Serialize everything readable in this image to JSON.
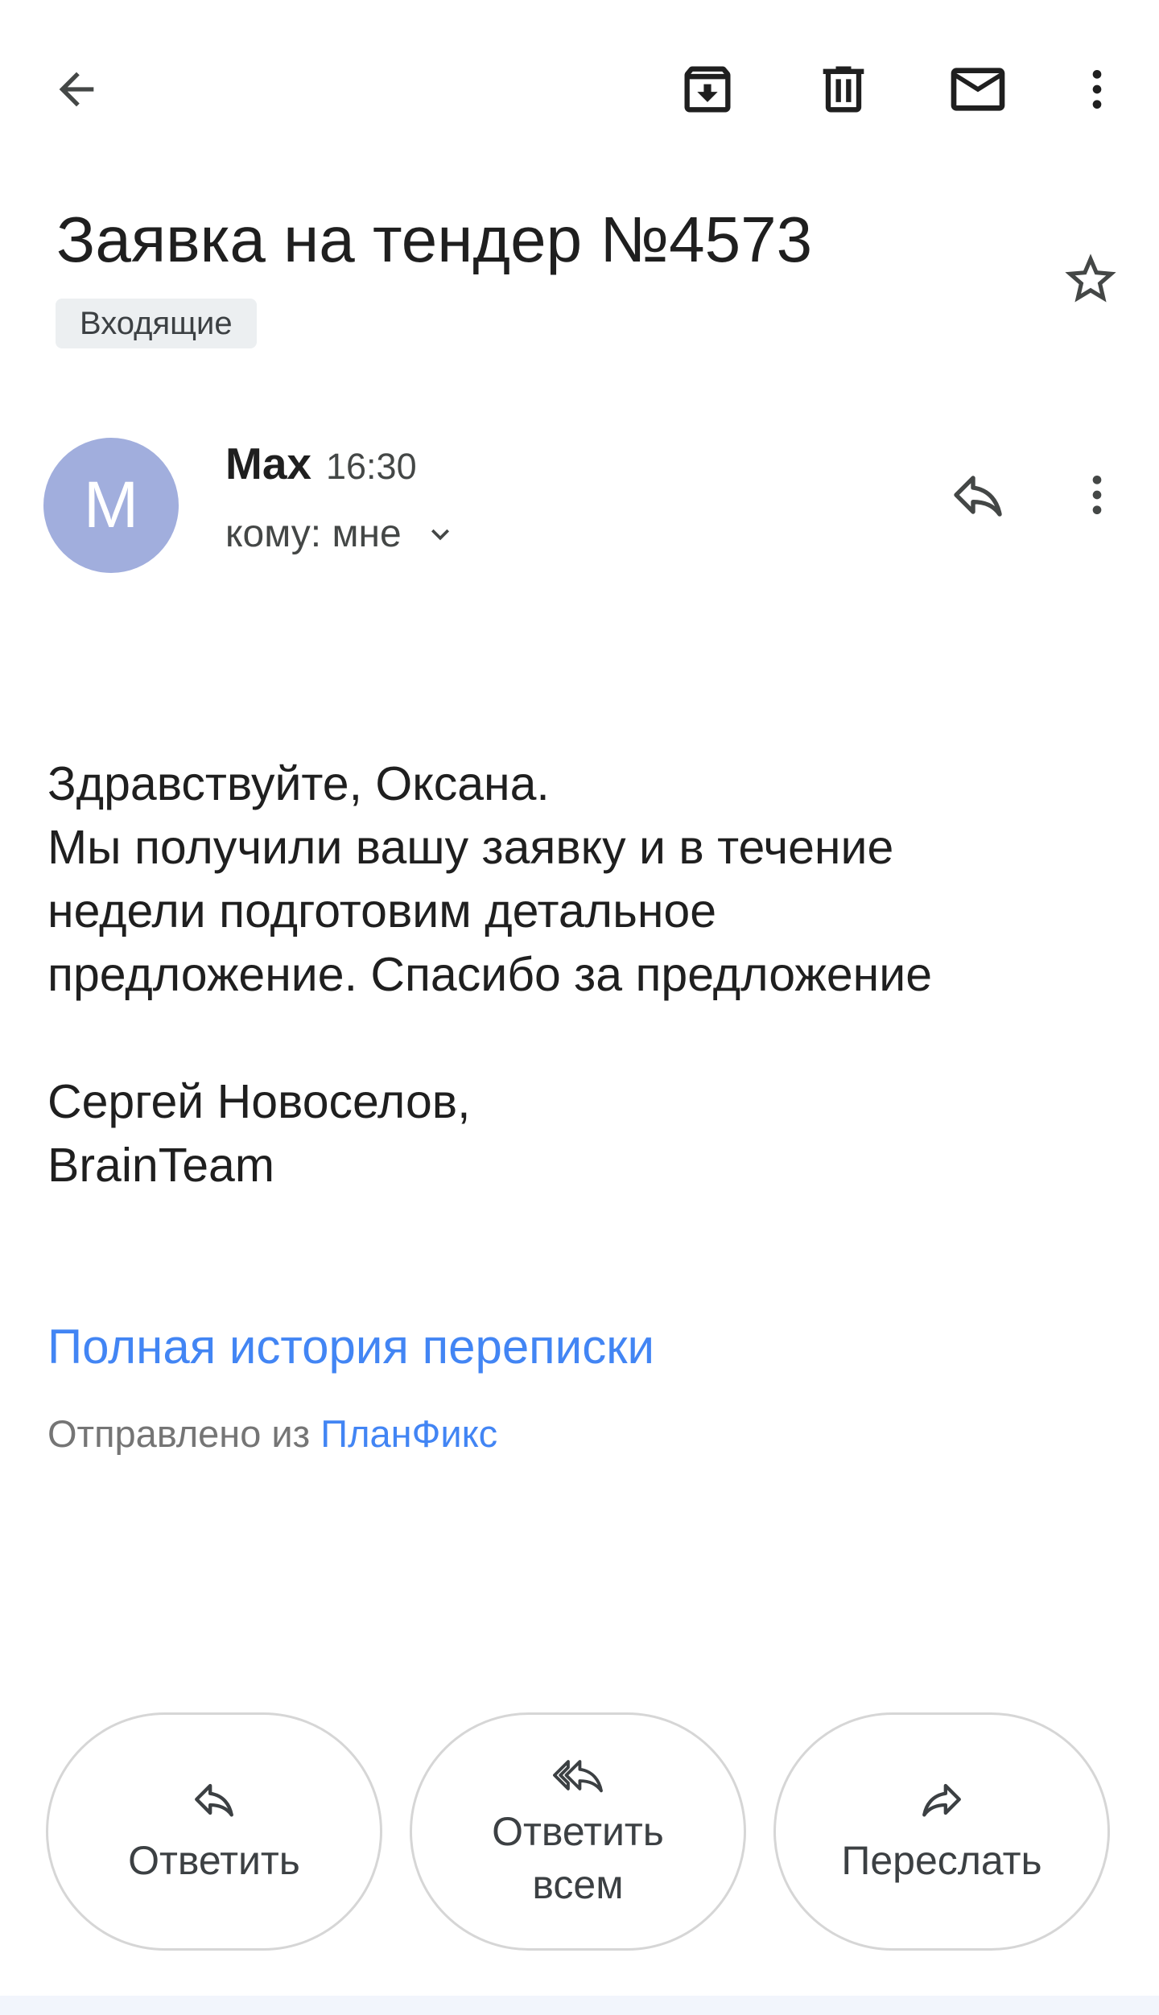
{
  "toolbar": {
    "back_icon": "arrow-back-icon",
    "archive_icon": "archive-icon",
    "delete_icon": "trash-icon",
    "mark_unread_icon": "mail-icon",
    "more_icon": "more-vert-icon"
  },
  "email": {
    "subject": "Заявка на тендер №4573",
    "label": "Входящие",
    "star_icon": "star-outline-icon",
    "sender": {
      "avatar_letter": "M",
      "avatar_color": "#a1aedd",
      "name": "Max",
      "time": "16:30",
      "recipient": "кому: мне"
    },
    "body": {
      "greeting": "Здравствуйте, Оксана.",
      "lines": [
        "Мы получили вашу заявку и в течение",
        "недели подготовим детальное",
        "предложение. Спасибо за предложение"
      ],
      "signature": [
        "Сергей Новоселов,",
        "BrainTeam"
      ]
    },
    "history_link": "Полная история переписки",
    "sent_from_prefix": "Отправлено из",
    "sent_from_app": "ПланФикс"
  },
  "actions": {
    "reply": "Ответить",
    "reply_all_line1": "Ответить",
    "reply_all_line2": "всем",
    "forward": "Переслать"
  },
  "colors": {
    "link": "#4285f4",
    "text": "#1f1f1f",
    "muted": "#757575",
    "icon": "#444746"
  }
}
